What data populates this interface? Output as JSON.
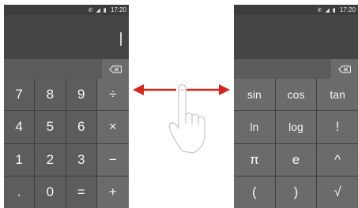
{
  "status_bar": {
    "icons": "✆ ◢ ▮",
    "time": "17:20"
  },
  "left_calculator": {
    "backspace_icon": "backspace-icon",
    "keys": [
      {
        "label": "7",
        "name": "key-7"
      },
      {
        "label": "8",
        "name": "key-8"
      },
      {
        "label": "9",
        "name": "key-9"
      },
      {
        "label": "÷",
        "name": "key-divide"
      },
      {
        "label": "4",
        "name": "key-4"
      },
      {
        "label": "5",
        "name": "key-5"
      },
      {
        "label": "6",
        "name": "key-6"
      },
      {
        "label": "×",
        "name": "key-multiply"
      },
      {
        "label": "1",
        "name": "key-1"
      },
      {
        "label": "2",
        "name": "key-2"
      },
      {
        "label": "3",
        "name": "key-3"
      },
      {
        "label": "−",
        "name": "key-minus"
      },
      {
        "label": ".",
        "name": "key-decimal"
      },
      {
        "label": "0",
        "name": "key-0"
      },
      {
        "label": "=",
        "name": "key-equals"
      },
      {
        "label": "+",
        "name": "key-plus"
      }
    ]
  },
  "right_calculator": {
    "backspace_icon": "backspace-icon",
    "keys": [
      {
        "label": "sin",
        "name": "key-sin"
      },
      {
        "label": "cos",
        "name": "key-cos"
      },
      {
        "label": "tan",
        "name": "key-tan"
      },
      {
        "label": "ln",
        "name": "key-ln"
      },
      {
        "label": "log",
        "name": "key-log"
      },
      {
        "label": "!",
        "name": "key-factorial"
      },
      {
        "label": "π",
        "name": "key-pi"
      },
      {
        "label": "e",
        "name": "key-e"
      },
      {
        "label": "^",
        "name": "key-power"
      },
      {
        "label": "(",
        "name": "key-open-paren"
      },
      {
        "label": ")",
        "name": "key-close-paren"
      },
      {
        "label": "√",
        "name": "key-sqrt"
      }
    ]
  },
  "gesture": {
    "hand_icon": "swipe-hand-icon",
    "arrow_icon": "left-right-arrow-icon",
    "arrow_color": "#d7261e"
  },
  "colors": {
    "key": "#5d5d5d",
    "operator_key": "#6b6b6b",
    "display": "#454545",
    "status_bar": "#3d3d3d"
  }
}
